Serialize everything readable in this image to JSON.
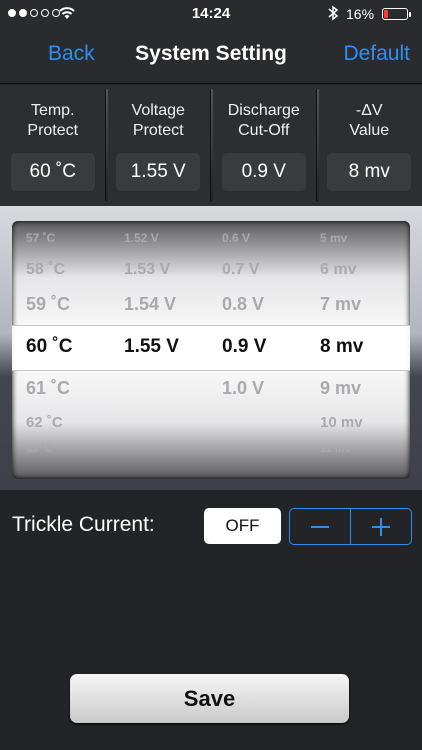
{
  "status_bar": {
    "time": "14:24",
    "battery_percent": "16%",
    "signal_bars_filled": 2,
    "icons": [
      "signal-dots",
      "wifi-icon",
      "bluetooth-icon",
      "battery-icon"
    ]
  },
  "nav": {
    "back_label": "Back",
    "title": "System Setting",
    "default_label": "Default",
    "accent_color": "#2f8ef4"
  },
  "settings": [
    {
      "label_line1": "Temp.",
      "label_line2": "Protect",
      "value": "60 ˚C"
    },
    {
      "label_line1": "Voltage",
      "label_line2": "Protect",
      "value": "1.55 V"
    },
    {
      "label_line1": "Discharge",
      "label_line2": "Cut-Off",
      "value": "0.9 V"
    },
    {
      "label_line1": "-ΔV",
      "label_line2": "Value",
      "value": "8 mv"
    }
  ],
  "picker": {
    "rows": [
      {
        "c1": "57 ˚C",
        "c2": "1.52 V",
        "c3": "0.6 V",
        "c4": "5 mv"
      },
      {
        "c1": "58 ˚C",
        "c2": "1.53 V",
        "c3": "0.7 V",
        "c4": "6 mv"
      },
      {
        "c1": "59 ˚C",
        "c2": "1.54 V",
        "c3": "0.8 V",
        "c4": "7 mv"
      },
      {
        "c1": "60 ˚C",
        "c2": "1.55 V",
        "c3": "0.9 V",
        "c4": "8 mv"
      },
      {
        "c1": "61 ˚C",
        "c2": "",
        "c3": "1.0 V",
        "c4": "9 mv"
      },
      {
        "c1": "62 ˚C",
        "c2": "",
        "c3": "",
        "c4": "10 mv"
      },
      {
        "c1": "63 ˚C",
        "c2": "",
        "c3": "",
        "c4": "11 mv"
      }
    ],
    "selected_index": 3
  },
  "trickle": {
    "label": "Trickle Current:",
    "value": "OFF",
    "minus_icon": "minus-icon",
    "plus_icon": "plus-icon"
  },
  "save_label": "Save"
}
